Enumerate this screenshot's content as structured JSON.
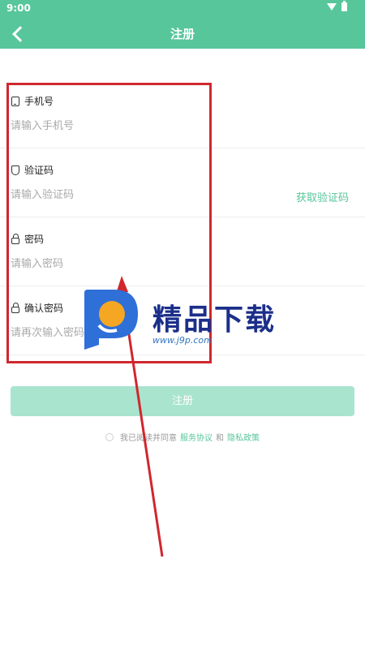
{
  "status": {
    "time": "9:00"
  },
  "header": {
    "title": "注册"
  },
  "fields": {
    "phone": {
      "label": "手机号",
      "placeholder": "请输入手机号"
    },
    "code": {
      "label": "验证码",
      "placeholder": "请输入验证码",
      "action": "获取验证码"
    },
    "password": {
      "label": "密码",
      "placeholder": "请输入密码"
    },
    "confirm": {
      "label": "确认密码",
      "placeholder": "请再次输入密码"
    }
  },
  "submit_label": "注册",
  "agreement": {
    "prefix": "我已阅读并同意",
    "terms": "服务协议",
    "and": "和",
    "privacy": "隐私政策"
  },
  "watermark": {
    "name": "精品下载",
    "url": "www.j9p.com"
  },
  "colors": {
    "accent": "#57c69b",
    "button_disabled": "#a9e4cf",
    "annotation": "#d0272e"
  }
}
